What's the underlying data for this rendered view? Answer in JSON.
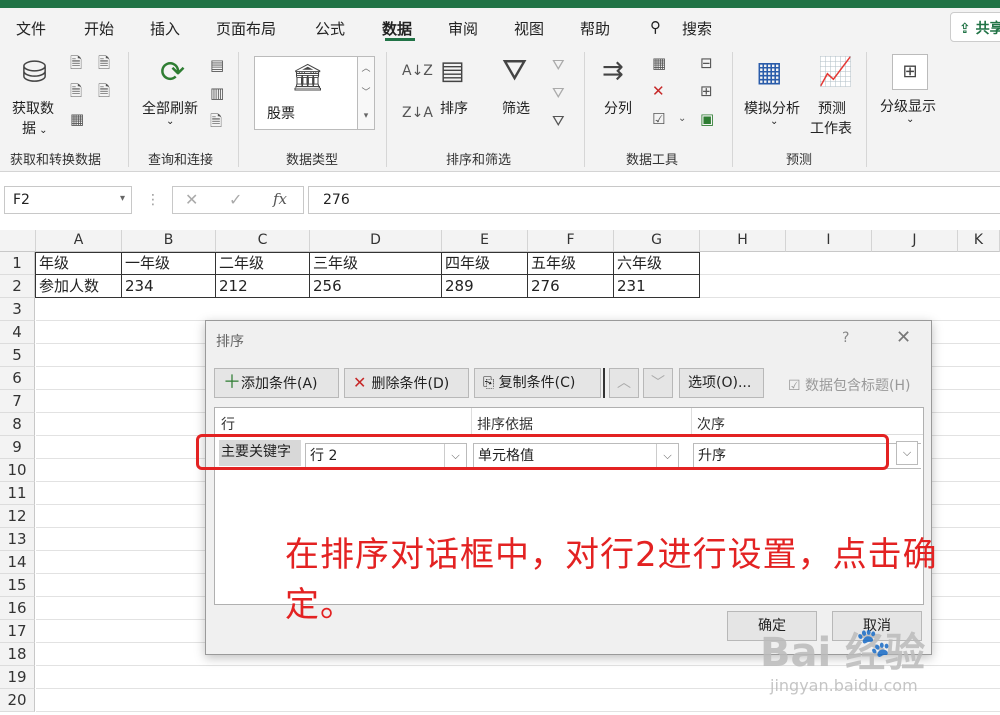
{
  "menu": {
    "items": [
      "文件",
      "开始",
      "插入",
      "页面布局",
      "公式",
      "数据",
      "审阅",
      "视图",
      "帮助"
    ],
    "search": "搜索",
    "share": "共享"
  },
  "ribbon": {
    "groups": {
      "get": "获取和转换数据",
      "query": "查询和连接",
      "datatype": "数据类型",
      "sort": "排序和筛选",
      "tools": "数据工具",
      "forecast": "预测"
    },
    "buttons": {
      "get_data_1": "获取数",
      "get_data_2": "据",
      "refresh_all": "全部刷新",
      "stock": "股票",
      "sort": "排序",
      "filter": "筛选",
      "split": "分列",
      "whatif": "模拟分析",
      "forecast_1": "预测",
      "forecast_2": "工作表",
      "outline": "分级显示"
    }
  },
  "formula_bar": {
    "name_box": "F2",
    "formula": "276"
  },
  "sheet": {
    "columns": [
      "A",
      "B",
      "C",
      "D",
      "E",
      "F",
      "G",
      "H",
      "I",
      "J",
      "K"
    ],
    "rows": [
      "1",
      "2",
      "3",
      "4",
      "5",
      "6",
      "7",
      "8",
      "9",
      "10",
      "11",
      "12",
      "13",
      "14",
      "15",
      "16",
      "17",
      "18",
      "19",
      "20"
    ],
    "row1": [
      "年级",
      "一年级",
      "二年级",
      "三年级",
      "四年级",
      "五年级",
      "六年级"
    ],
    "row2": [
      "参加人数",
      "234",
      "212",
      "256",
      "289",
      "276",
      "231"
    ]
  },
  "dialog": {
    "title": "排序",
    "help": "?",
    "add_condition": "添加条件(A)",
    "delete_condition": "删除条件(D)",
    "copy_condition": "复制条件(C)",
    "options": "选项(O)...",
    "has_header": "数据包含标题(H)",
    "headers": {
      "row": "行",
      "sort_on": "排序依据",
      "order": "次序"
    },
    "rule": {
      "label": "主要关键字",
      "row_value": "行 2",
      "sort_on_value": "单元格值",
      "order_value": "升序"
    },
    "ok": "确定",
    "cancel": "取消"
  },
  "annotation": {
    "text": "在排序对话框中，对行2进行设置，点击确定。"
  },
  "watermark": {
    "brand": "Bai  经验",
    "url": "jingyan.baidu.com"
  },
  "colors": {
    "excel_green": "#217346",
    "annotation_red": "#e32222"
  }
}
